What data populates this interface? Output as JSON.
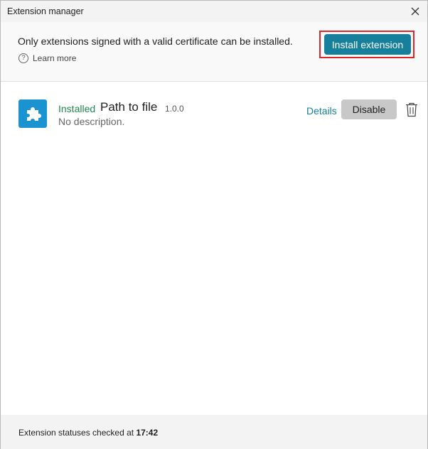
{
  "window": {
    "title": "Extension manager"
  },
  "info": {
    "message": "Only extensions signed with a valid certificate can be installed.",
    "learn_more": "Learn more",
    "install_button": "Install extension"
  },
  "extensions": [
    {
      "status": "Installed",
      "name": "Path to file",
      "version": "1.0.0",
      "description": "No description.",
      "details_label": "Details",
      "disable_label": "Disable",
      "icon": "puzzle-icon"
    }
  ],
  "footer": {
    "status_prefix": "Extension statuses checked at",
    "status_time": "17:42"
  },
  "colors": {
    "accent": "#167f9b",
    "installed_green": "#1f8a4c",
    "extension_icon_bg": "#1a93d0",
    "highlight_red": "#e0242c"
  }
}
